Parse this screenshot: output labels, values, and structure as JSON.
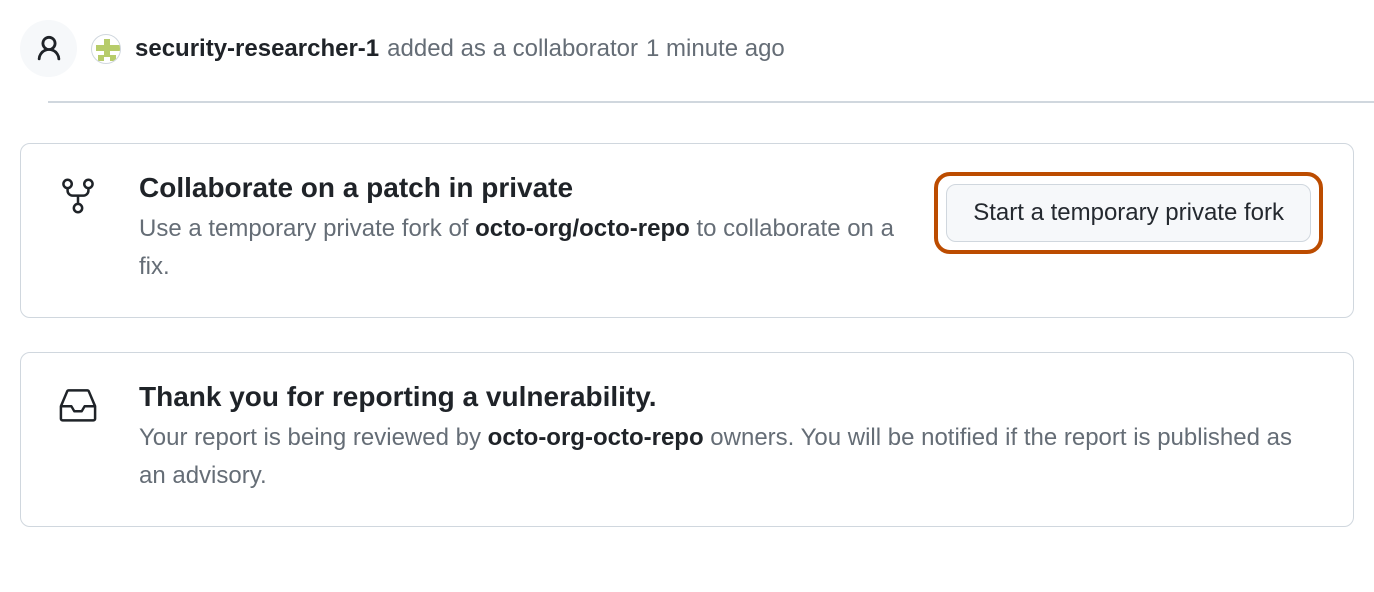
{
  "timeline": {
    "username": "security-researcher-1",
    "action": "added as a collaborator",
    "timestamp": "1 minute ago"
  },
  "cards": {
    "collaborate": {
      "title": "Collaborate on a patch in private",
      "desc_pre": "Use a temporary private fork of ",
      "repo": "octo-org/octo-repo",
      "desc_post": " to collaborate on a fix.",
      "button": "Start a temporary private fork"
    },
    "thanks": {
      "title": "Thank you for reporting a vulnerability.",
      "desc_pre": "Your report is being reviewed by ",
      "repo": "octo-org-octo-repo",
      "desc_post": " owners. You will be notified if the report is published as an advisory."
    }
  }
}
